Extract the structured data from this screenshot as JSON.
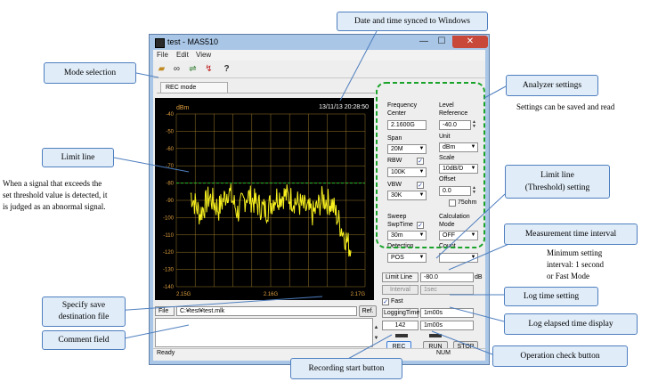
{
  "window": {
    "title": "test - MAS510",
    "min_glyph": "—",
    "max_glyph": "☐",
    "close_glyph": "✕"
  },
  "menu": {
    "items": [
      "File",
      "Edit",
      "View"
    ]
  },
  "toolbar": {
    "icons": [
      "open-folder-icon",
      "binoculars-icon",
      "transfer-icon",
      "record-icon",
      "help-icon"
    ]
  },
  "tab": {
    "label": "REC mode"
  },
  "spectrum": {
    "timestamp": "13/11/13 20:28:50",
    "unit": "dBm",
    "threshold_dbm": -80.0,
    "background": "#000000",
    "trace_color": "#f7f01e",
    "grid_color": "#9a7a2a"
  },
  "chart_data": {
    "type": "line",
    "x_ticks": [
      "2.15G",
      "2.16G",
      "2.17G"
    ],
    "xlim": [
      2.15,
      2.17
    ],
    "y_ticks": [
      -40,
      -50,
      -60,
      -70,
      -80,
      -90,
      -100,
      -110,
      -120,
      -130,
      -140
    ],
    "ylim": [
      -140,
      -40
    ],
    "unit": "dBm",
    "limit_line": -80,
    "series": [
      {
        "x": [
          2.1515,
          2.1525,
          2.1535,
          2.1545,
          2.1555,
          2.1565,
          2.1575,
          2.1585,
          2.1595,
          2.1605,
          2.1615,
          2.1625,
          2.1635,
          2.1645,
          2.1655,
          2.1665,
          2.1675,
          2.1685
        ],
        "y": [
          -86,
          -98,
          -88,
          -95,
          -84,
          -97,
          -87,
          -92,
          -96,
          -88,
          -87,
          -90,
          -94,
          -98,
          -89,
          -92,
          -106,
          -119
        ]
      }
    ]
  },
  "analyzer": {
    "frequency_label": "Frequency",
    "center_label": "Center",
    "center_value": "2.1600G",
    "span_label": "Span",
    "span_value": "20M",
    "rbw_label": "RBW",
    "rbw_value": "100K",
    "vbw_label": "VBW",
    "vbw_value": "30K",
    "sweep_label": "Sweep",
    "swptime_label": "SwpTime",
    "swptime_value": "30m",
    "detection_label": "Detection",
    "detection_value": "POS",
    "level_label": "Level",
    "reference_label": "Reference",
    "reference_value": "-40.0",
    "unit_label": "Unit",
    "unit_value": "dBm",
    "scale_label": "Scale",
    "scale_value": "10dB/D",
    "offset_label": "Offset",
    "offset_value": "0.0",
    "ohm_label": "75ohm",
    "calculation_label": "Calculation",
    "mode_label": "Mode",
    "mode_value": "OFF",
    "count_label": "Count",
    "count_value": ""
  },
  "limit": {
    "label": "Limit Line",
    "value": "-80.0",
    "unit": "dB",
    "interval_label": "Interval",
    "interval_value": "1sec",
    "fast_label": "Fast"
  },
  "file": {
    "label": "File",
    "path": "C:¥test¥test.mlk",
    "ref_button": "Ref."
  },
  "logging": {
    "label": "LoggingTime",
    "time_value": "1m00s",
    "count": "142",
    "elapsed": "1m00s"
  },
  "buttons": {
    "rec": "REC",
    "run": "RUN",
    "stop": "STOP"
  },
  "status": {
    "left": "Ready",
    "right": "NUM"
  },
  "annotations": {
    "date_time": "Date and time synced to Windows",
    "mode_selection": "Mode selection",
    "analyzer_settings": "Analyzer settings",
    "settings_note": "Settings can be saved and read",
    "limit_line": "Limit line",
    "limit_note": [
      "When a signal that exceeds the",
      "set threshold value is detected, it",
      "is judged as an abnormal signal."
    ],
    "limit_setting": [
      "Limit line",
      "(Threshold) setting"
    ],
    "measurement_interval": "Measurement time interval",
    "interval_note": [
      "Minimum setting",
      "interval: 1 second",
      "or Fast Mode"
    ],
    "save_file": [
      "Specify save",
      "destination file"
    ],
    "log_time": "Log time setting",
    "comment_field": "Comment field",
    "log_elapsed": "Log elapsed time display",
    "operation_check": "Operation check button",
    "rec_start": "Recording start button"
  }
}
